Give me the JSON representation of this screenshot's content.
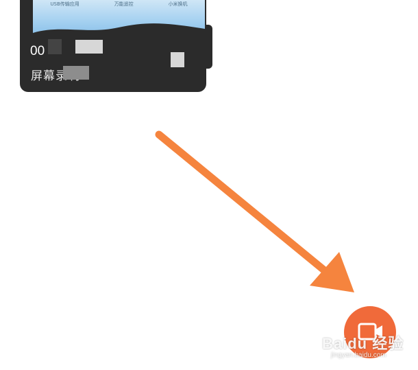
{
  "card": {
    "thumbnail_labels": [
      "USB传输应用",
      "万能遥控",
      "小米换机"
    ],
    "time_text": "00",
    "title_text": "屏幕录制"
  },
  "record_button": {
    "icon": "video-camera-icon",
    "color": "#f06a3a"
  },
  "arrow": {
    "color": "#f5843e"
  },
  "watermark": {
    "logo_text": "Baidu 经验",
    "url_text": "jingyan.baidu.com"
  }
}
